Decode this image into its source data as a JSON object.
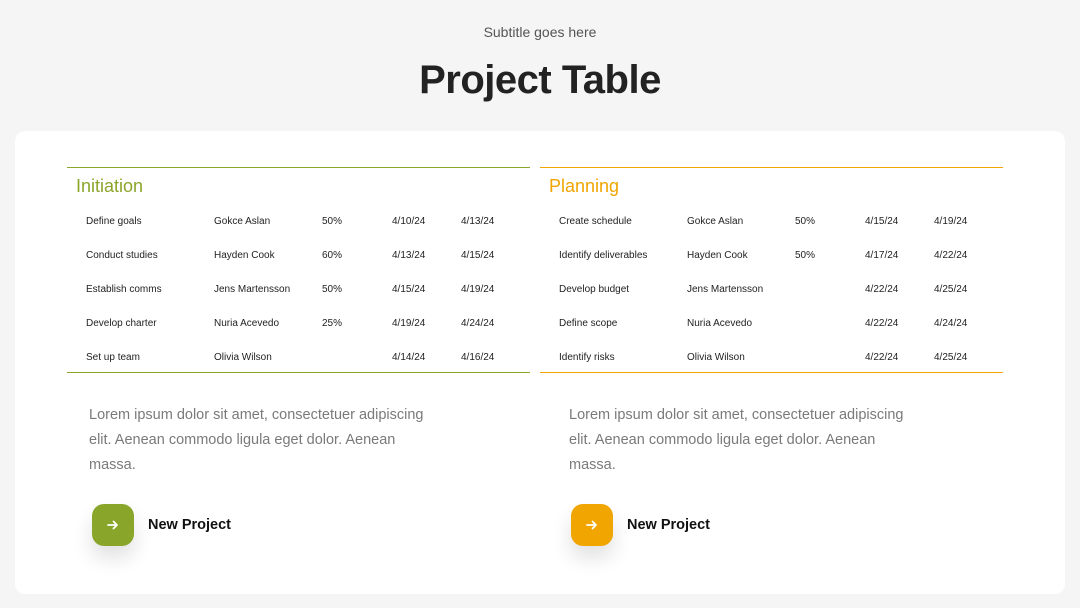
{
  "header": {
    "subtitle": "Subtitle goes here",
    "title": "Project Table"
  },
  "colors": {
    "initiation": "#8aa62a",
    "planning": "#f0a500"
  },
  "sections": [
    {
      "title": "Initiation",
      "rows": [
        {
          "task": "Define goals",
          "owner": "Gokce Aslan",
          "pct": "50%",
          "start": "4/10/24",
          "end": "4/13/24"
        },
        {
          "task": "Conduct studies",
          "owner": "Hayden Cook",
          "pct": "60%",
          "start": "4/13/24",
          "end": "4/15/24"
        },
        {
          "task": "Establish comms",
          "owner": "Jens Martensson",
          "pct": "50%",
          "start": "4/15/24",
          "end": "4/19/24"
        },
        {
          "task": "Develop charter",
          "owner": "Nuria Acevedo",
          "pct": "25%",
          "start": "4/19/24",
          "end": "4/24/24"
        },
        {
          "task": "Set up team",
          "owner": "Olivia Wilson",
          "pct": "",
          "start": "4/14/24",
          "end": "4/16/24"
        }
      ],
      "description": "Lorem ipsum dolor sit amet, consectetuer adipiscing elit. Aenean commodo ligula eget dolor. Aenean massa.",
      "button_label": "New Project",
      "button_icon": "arrow-right-icon"
    },
    {
      "title": "Planning",
      "rows": [
        {
          "task": "Create schedule",
          "owner": "Gokce Aslan",
          "pct": "50%",
          "start": "4/15/24",
          "end": "4/19/24"
        },
        {
          "task": "Identify deliverables",
          "owner": "Hayden Cook",
          "pct": "50%",
          "start": "4/17/24",
          "end": "4/22/24"
        },
        {
          "task": "Develop budget",
          "owner": "Jens Martensson",
          "pct": "",
          "start": "4/22/24",
          "end": "4/25/24"
        },
        {
          "task": "Define scope",
          "owner": "Nuria Acevedo",
          "pct": "",
          "start": "4/22/24",
          "end": "4/24/24"
        },
        {
          "task": "Identify risks",
          "owner": "Olivia Wilson",
          "pct": "",
          "start": "4/22/24",
          "end": "4/25/24"
        }
      ],
      "description": "Lorem ipsum dolor sit amet, consectetuer adipiscing elit. Aenean commodo ligula eget dolor. Aenean massa.",
      "button_label": "New Project",
      "button_icon": "arrow-right-icon"
    }
  ]
}
